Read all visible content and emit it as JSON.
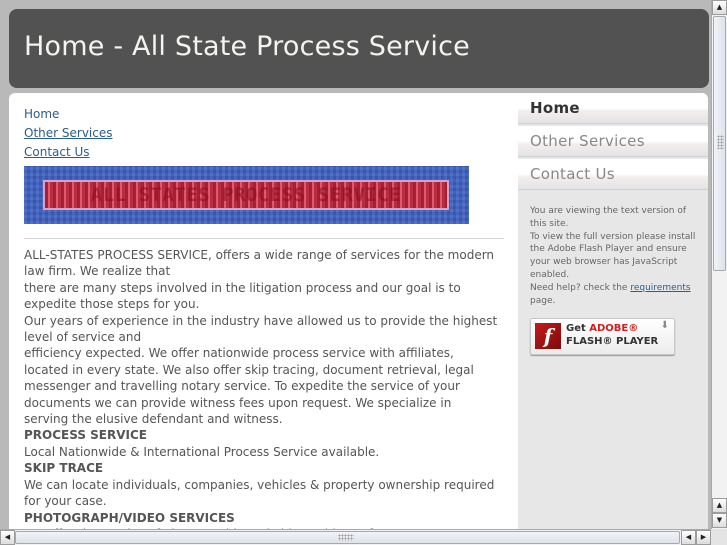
{
  "header": {
    "title": "Home - All State Process Service"
  },
  "content": {
    "top_nav": [
      {
        "label": "Home",
        "underlined": false
      },
      {
        "label": "Other Services",
        "underlined": true
      },
      {
        "label": "Contact Us",
        "underlined": true
      }
    ],
    "banner": {
      "text": "ALL STATES PROCESS SERVICE",
      "colors": {
        "background": "#3c5fc0",
        "band": "#c93a4f"
      }
    },
    "paragraphs": [
      {
        "type": "text",
        "text": "ALL-STATES PROCESS SERVICE, offers a wide range of services for the modern law firm. We realize that"
      },
      {
        "type": "text",
        "text": "there are many steps involved in the litigation process and our goal is to expedite those steps for you."
      },
      {
        "type": "text",
        "text": "Our years of experience in the industry have allowed us to provide the highest level of service and"
      },
      {
        "type": "text",
        "text": "efficiency expected. We offer nationwide process service with affiliates, located in every state. We also offer skip tracing, document retrieval, legal messenger and travelling notary service. To expedite the service of your documents we can provide witness fees upon request. We specialize in serving the elusive defendant and witness."
      },
      {
        "type": "heading",
        "text": "PROCESS SERVICE"
      },
      {
        "type": "text",
        "text": "Local Nationwide & International Process Service available."
      },
      {
        "type": "heading",
        "text": "SKIP TRACE"
      },
      {
        "type": "text",
        "text": "We can locate individuals, companies, vehicles & property ownership required for your case."
      },
      {
        "type": "heading",
        "text": "PHOTOGRAPH/VIDEO SERVICES"
      },
      {
        "type": "text",
        "text": "We offer the service of photographic and video evidence for court."
      }
    ]
  },
  "sidebar": {
    "nav": [
      {
        "label": "Home",
        "active": true
      },
      {
        "label": "Other Services",
        "active": false
      },
      {
        "label": "Contact Us",
        "active": false
      }
    ],
    "flash_note": {
      "line1": "You are viewing the text version of this site.",
      "line2": "To view the full version please install the Adobe Flash Player and ensure your web browser has JavaScript enabled.",
      "line3_prefix": "Need help? check the ",
      "link": "requirements",
      "line3_suffix": " page."
    },
    "flash_badge": {
      "get": "Get ",
      "adobe": "ADOBE®",
      "player": "FLASH® PLAYER",
      "logo_glyph": "f",
      "download_icon": "⬇"
    }
  },
  "colors": {
    "header_bg": "#525252",
    "header_text": "#f4f4ee",
    "link": "#2a5e8c",
    "body_text": "#555555",
    "page_bg": "#b9b9b9",
    "sidebar_bg": "#e7e7e7"
  },
  "scrollbars": {
    "up_arrow": "▲",
    "down_arrow": "▼",
    "left_arrow": "◀",
    "right_arrow": "▶"
  }
}
